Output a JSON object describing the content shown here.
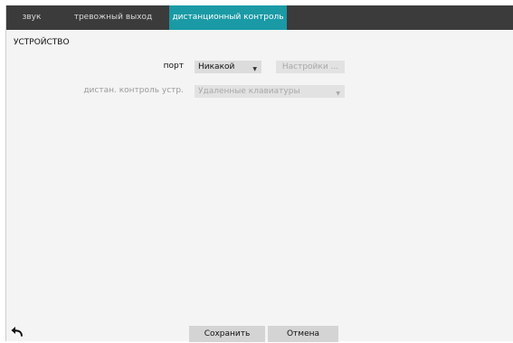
{
  "tabs": [
    {
      "label": "звук"
    },
    {
      "label": "тревожный выход"
    },
    {
      "label": "дистанционный контроль"
    }
  ],
  "section": {
    "title": "УСТРОЙСТВО"
  },
  "port": {
    "label": "порт",
    "value": "Никакой",
    "setup_button": "Настройки ..."
  },
  "remote_device": {
    "label": "дистан. контроль устр.",
    "value": "Удаленные клавиатуры"
  },
  "footer": {
    "save": "Сохранить",
    "cancel": "Отмена"
  },
  "colors": {
    "tabbar": "#3b3b3b",
    "active_tab": "#1a9aa5",
    "background": "#f4f4f4"
  },
  "icons": {
    "back": "back-arrow-icon",
    "dropdown": "chevron-down-icon"
  }
}
